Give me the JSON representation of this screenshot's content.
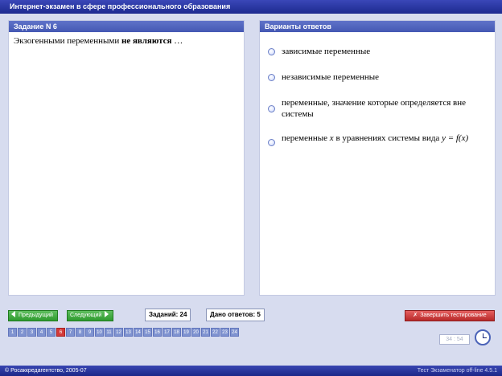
{
  "window": {
    "title": "Интернет-экзамен в сфере профессионального образования"
  },
  "question_panel": {
    "header": "Задание N 6",
    "text_normal": "Экзогенными переменными ",
    "text_bold": "не являются",
    "text_tail": " …"
  },
  "answers_panel": {
    "header": "Варианты ответов",
    "options": [
      {
        "text": "зависимые переменные"
      },
      {
        "text": "независимые переменные"
      },
      {
        "text": "переменные, значение которые определяется вне системы"
      },
      {
        "text_before": "переменные ",
        "var_x": "x",
        "text_middle": " в уравнениях системы вида ",
        "formula": "y = f(x)"
      }
    ]
  },
  "controls": {
    "prev_label": "Предыдущий",
    "next_label": "Следующий",
    "tasks_count": "Заданий: 24",
    "answers_given": "Дано ответов: 5",
    "finish_label": "Завершить тестирование",
    "finish_icon": "runner-icon"
  },
  "pager": {
    "pages": [
      "1",
      "2",
      "3",
      "4",
      "5",
      "6",
      "7",
      "8",
      "9",
      "10",
      "11",
      "12",
      "13",
      "14",
      "15",
      "16",
      "17",
      "18",
      "19",
      "20",
      "21",
      "22",
      "23",
      "24"
    ],
    "current": "6"
  },
  "timer": {
    "value": "34 : 54"
  },
  "footer": {
    "left": "© Росаккредагентство, 2005-07",
    "right": "Тест Экзаменатор off-line 4.5.1"
  },
  "colors": {
    "title_bar": "#2a37a0",
    "panel_header": "#5065be",
    "nav_green": "#3aa63a",
    "finish_red": "#c93535",
    "page_current": "#d33a3a"
  }
}
